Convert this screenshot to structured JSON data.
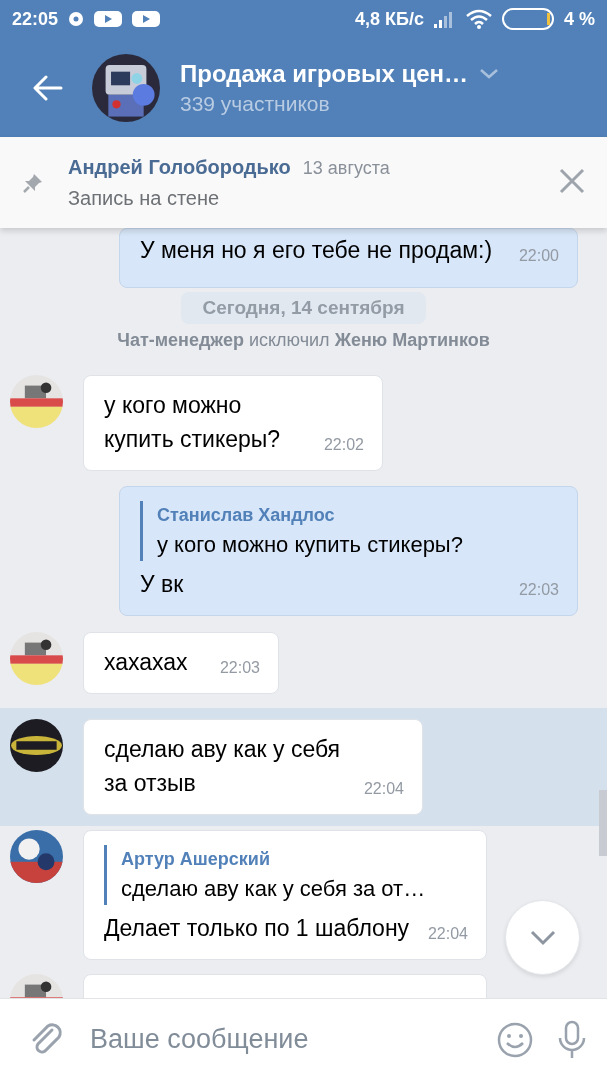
{
  "status_bar": {
    "time": "22:05",
    "speed": "4,8 КБ/с",
    "battery": "4 %"
  },
  "header": {
    "title": "Продажа игровых цен…",
    "subtitle": "339 участников"
  },
  "pinned": {
    "author": "Андрей Голобородько",
    "date": "13 августа",
    "text": "Запись на стене"
  },
  "date_badge": "Сегодня, 14 сентября",
  "messages": [
    {
      "kind": "text",
      "outgoing": true,
      "highlighted": false,
      "text": "У меня но я его тебе не продам:)",
      "time": "22:00"
    },
    {
      "kind": "system",
      "actor": "Чат-менеджер",
      "action": "исключил",
      "target": "Женю Мартинков"
    },
    {
      "kind": "text",
      "outgoing": false,
      "highlighted": false,
      "text": "у кого можно купить стикеры?",
      "time": "22:02"
    },
    {
      "kind": "reply",
      "outgoing": true,
      "highlighted": false,
      "reply_author": "Станислав Хандлос",
      "reply_text": "у кого можно купить стикеры?",
      "text": "У вк",
      "time": "22:03"
    },
    {
      "kind": "text",
      "outgoing": false,
      "highlighted": false,
      "text": "хахахах",
      "time": "22:03"
    },
    {
      "kind": "text",
      "outgoing": false,
      "highlighted": true,
      "text": "сделаю аву как у себя за отзыв",
      "time": "22:04"
    },
    {
      "kind": "reply",
      "outgoing": false,
      "highlighted": false,
      "reply_author": "Артур Ашерский",
      "reply_text": "сделаю аву как у себя за от…",
      "text": "Делает только по 1 шаблону",
      "time": "22:04"
    },
    {
      "kind": "partial",
      "outgoing": false,
      "highlighted": false
    }
  ],
  "composer": {
    "placeholder": "Ваше сообщение"
  }
}
